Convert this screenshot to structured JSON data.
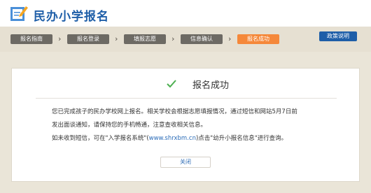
{
  "header": {
    "site_title": "民办小学报名",
    "logo_icon": "pencil-document-logo"
  },
  "steps": [
    {
      "label": "报名指南",
      "active": false
    },
    {
      "label": "报名登录",
      "active": false
    },
    {
      "label": "填报志愿",
      "active": false
    },
    {
      "label": "信息确认",
      "active": false
    },
    {
      "label": "报名成功",
      "active": true
    }
  ],
  "policy_button": "政策说明",
  "result": {
    "title": "报名成功",
    "check_icon": "check-icon",
    "line1": "您已完成孩子的民办学校网上报名。相关学校会根据志愿填报情况，通过短信和网站5月7日前",
    "line2": "发出面谈通知，请保持您的手机畅通，注意查收相关信息。",
    "line3_prefix": "如未收到短信，可在\"入学报名系统\"(",
    "line3_link": "www.shrxbm.cn",
    "line3_suffix": ")点击\"幼升小报名信息\"进行查询。",
    "close_label": "关闭"
  },
  "colors": {
    "brand_blue": "#1f5fa8",
    "active_orange": "#f5883a",
    "step_gray": "#6d6a64",
    "check_green": "#4caf50"
  }
}
